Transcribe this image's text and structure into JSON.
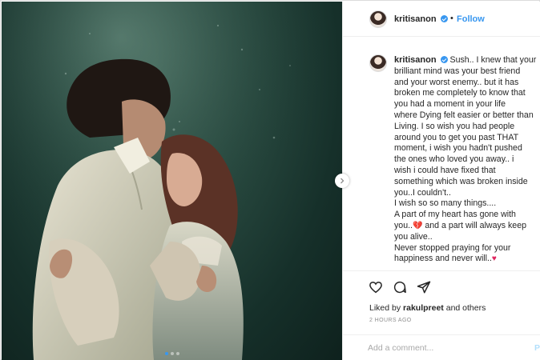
{
  "post": {
    "username": "kritisanon",
    "follow_label": "Follow",
    "separator": "•",
    "caption_lines": [
      "Sush.. I knew that your",
      "brilliant mind was your best friend",
      "and your worst enemy.. but it has",
      "broken me completely to know that",
      "you had a moment in your life",
      "where Dying felt easier or better than",
      "Living. I so wish you had people",
      "around you to get you past THAT",
      "moment, i wish you hadn't pushed",
      "the ones who loved you away.. i",
      "wish i could have fixed that",
      "something which was broken inside",
      "you..I couldn't..",
      "I wish so so many things....",
      "A part of my heart has gone with",
      "you..",
      "and a part will always keep",
      "you alive..",
      "Never stopped praying for your",
      "happiness and never will.."
    ],
    "likes_prefix": "Liked by",
    "likes_user": "rakulpreet",
    "likes_suffix": "and others",
    "timestamp": "2 HOURS AGO",
    "comment_placeholder": "Add a comment...",
    "post_label": "P",
    "carousel": {
      "count": 3,
      "active_index": 0
    }
  },
  "icons": {
    "like": "heart-outline-icon",
    "comment": "speech-bubble-icon",
    "share": "paper-plane-icon",
    "verified": "verified-badge-icon",
    "next": "chevron-right-icon",
    "broken_heart": "broken-heart-emoji",
    "red_heart": "red-heart-emoji"
  },
  "colors": {
    "link_blue": "#3897f0",
    "text": "#262626",
    "muted": "#8e8e8e",
    "heart_red": "#e0245e"
  }
}
